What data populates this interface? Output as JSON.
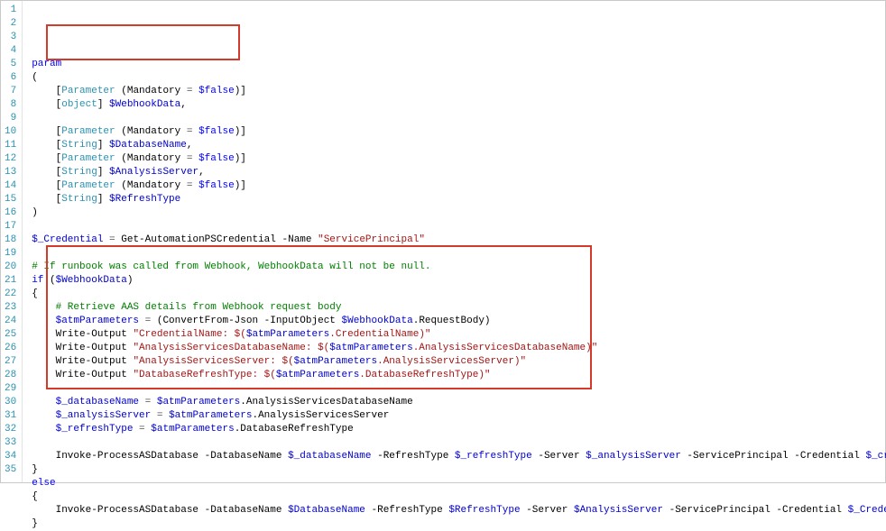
{
  "lines": [
    {
      "n": 1,
      "tokens": [
        {
          "t": "param",
          "c": "tok-kw"
        }
      ]
    },
    {
      "n": 2,
      "tokens": [
        {
          "t": "(",
          "c": "tok-p"
        }
      ]
    },
    {
      "n": 3,
      "tokens": [
        {
          "t": "    [",
          "c": "tok-p"
        },
        {
          "t": "Parameter",
          "c": "tok-type"
        },
        {
          "t": " (Mandatory ",
          "c": "tok-p"
        },
        {
          "t": "=",
          "c": "tok-op"
        },
        {
          "t": " ",
          "c": ""
        },
        {
          "t": "$false",
          "c": "tok-bool"
        },
        {
          "t": ")]",
          "c": "tok-p"
        }
      ]
    },
    {
      "n": 4,
      "tokens": [
        {
          "t": "    [",
          "c": "tok-p"
        },
        {
          "t": "object",
          "c": "tok-type"
        },
        {
          "t": "] ",
          "c": "tok-p"
        },
        {
          "t": "$WebhookData",
          "c": "tok-var"
        },
        {
          "t": ",",
          "c": "tok-p"
        }
      ]
    },
    {
      "n": 5,
      "tokens": [
        {
          "t": "",
          "c": ""
        }
      ]
    },
    {
      "n": 6,
      "tokens": [
        {
          "t": "    [",
          "c": "tok-p"
        },
        {
          "t": "Parameter",
          "c": "tok-type"
        },
        {
          "t": " (Mandatory ",
          "c": "tok-p"
        },
        {
          "t": "=",
          "c": "tok-op"
        },
        {
          "t": " ",
          "c": ""
        },
        {
          "t": "$false",
          "c": "tok-bool"
        },
        {
          "t": ")]",
          "c": "tok-p"
        }
      ]
    },
    {
      "n": 7,
      "tokens": [
        {
          "t": "    [",
          "c": "tok-p"
        },
        {
          "t": "String",
          "c": "tok-type"
        },
        {
          "t": "] ",
          "c": "tok-p"
        },
        {
          "t": "$DatabaseName",
          "c": "tok-var"
        },
        {
          "t": ",",
          "c": "tok-p"
        }
      ]
    },
    {
      "n": 8,
      "tokens": [
        {
          "t": "    [",
          "c": "tok-p"
        },
        {
          "t": "Parameter",
          "c": "tok-type"
        },
        {
          "t": " (Mandatory ",
          "c": "tok-p"
        },
        {
          "t": "=",
          "c": "tok-op"
        },
        {
          "t": " ",
          "c": ""
        },
        {
          "t": "$false",
          "c": "tok-bool"
        },
        {
          "t": ")]",
          "c": "tok-p"
        }
      ]
    },
    {
      "n": 9,
      "tokens": [
        {
          "t": "    [",
          "c": "tok-p"
        },
        {
          "t": "String",
          "c": "tok-type"
        },
        {
          "t": "] ",
          "c": "tok-p"
        },
        {
          "t": "$AnalysisServer",
          "c": "tok-var"
        },
        {
          "t": ",",
          "c": "tok-p"
        }
      ]
    },
    {
      "n": 10,
      "tokens": [
        {
          "t": "    [",
          "c": "tok-p"
        },
        {
          "t": "Parameter",
          "c": "tok-type"
        },
        {
          "t": " (Mandatory ",
          "c": "tok-p"
        },
        {
          "t": "=",
          "c": "tok-op"
        },
        {
          "t": " ",
          "c": ""
        },
        {
          "t": "$false",
          "c": "tok-bool"
        },
        {
          "t": ")]",
          "c": "tok-p"
        }
      ]
    },
    {
      "n": 11,
      "tokens": [
        {
          "t": "    [",
          "c": "tok-p"
        },
        {
          "t": "String",
          "c": "tok-type"
        },
        {
          "t": "] ",
          "c": "tok-p"
        },
        {
          "t": "$RefreshType",
          "c": "tok-var"
        }
      ]
    },
    {
      "n": 12,
      "tokens": [
        {
          "t": ")",
          "c": "tok-p"
        }
      ]
    },
    {
      "n": 13,
      "tokens": [
        {
          "t": "",
          "c": ""
        }
      ]
    },
    {
      "n": 14,
      "tokens": [
        {
          "t": "$_Credential",
          "c": "tok-var"
        },
        {
          "t": " ",
          "c": ""
        },
        {
          "t": "=",
          "c": "tok-op"
        },
        {
          "t": " ",
          "c": ""
        },
        {
          "t": "Get-AutomationPSCredential",
          "c": "tok-cmd"
        },
        {
          "t": " -Name ",
          "c": "tok-p"
        },
        {
          "t": "\"ServicePrincipal\"",
          "c": "tok-str"
        }
      ]
    },
    {
      "n": 15,
      "tokens": [
        {
          "t": "",
          "c": ""
        }
      ]
    },
    {
      "n": 16,
      "tokens": [
        {
          "t": "# If runbook was called from Webhook, WebhookData will not be null.",
          "c": "tok-com"
        }
      ]
    },
    {
      "n": 17,
      "tokens": [
        {
          "t": "if",
          "c": "tok-kw"
        },
        {
          "t": " (",
          "c": "tok-p"
        },
        {
          "t": "$WebhookData",
          "c": "tok-var"
        },
        {
          "t": ")",
          "c": "tok-p"
        }
      ]
    },
    {
      "n": 18,
      "tokens": [
        {
          "t": "{",
          "c": "tok-p"
        }
      ]
    },
    {
      "n": 19,
      "tokens": [
        {
          "t": "    ",
          "c": ""
        },
        {
          "t": "# Retrieve AAS details from Webhook request body",
          "c": "tok-com"
        }
      ]
    },
    {
      "n": 20,
      "tokens": [
        {
          "t": "    ",
          "c": ""
        },
        {
          "t": "$atmParameters",
          "c": "tok-var"
        },
        {
          "t": " ",
          "c": ""
        },
        {
          "t": "=",
          "c": "tok-op"
        },
        {
          "t": " (",
          "c": "tok-p"
        },
        {
          "t": "ConvertFrom-Json",
          "c": "tok-cmd"
        },
        {
          "t": " -InputObject ",
          "c": "tok-p"
        },
        {
          "t": "$WebhookData",
          "c": "tok-var"
        },
        {
          "t": ".RequestBody)",
          "c": "tok-prop"
        }
      ]
    },
    {
      "n": 21,
      "tokens": [
        {
          "t": "    ",
          "c": ""
        },
        {
          "t": "Write-Output",
          "c": "tok-cmd"
        },
        {
          "t": " ",
          "c": ""
        },
        {
          "t": "\"CredentialName: $(",
          "c": "tok-str"
        },
        {
          "t": "$atmParameters",
          "c": "tok-var"
        },
        {
          "t": ".CredentialName",
          "c": "tok-str"
        },
        {
          "t": ")\"",
          "c": "tok-str"
        }
      ]
    },
    {
      "n": 22,
      "tokens": [
        {
          "t": "    ",
          "c": ""
        },
        {
          "t": "Write-Output",
          "c": "tok-cmd"
        },
        {
          "t": " ",
          "c": ""
        },
        {
          "t": "\"AnalysisServicesDatabaseName: $(",
          "c": "tok-str"
        },
        {
          "t": "$atmParameters",
          "c": "tok-var"
        },
        {
          "t": ".AnalysisServicesDatabaseName",
          "c": "tok-str"
        },
        {
          "t": ")\"",
          "c": "tok-str"
        }
      ]
    },
    {
      "n": 23,
      "tokens": [
        {
          "t": "    ",
          "c": ""
        },
        {
          "t": "Write-Output",
          "c": "tok-cmd"
        },
        {
          "t": " ",
          "c": ""
        },
        {
          "t": "\"AnalysisServicesServer: $(",
          "c": "tok-str"
        },
        {
          "t": "$atmParameters",
          "c": "tok-var"
        },
        {
          "t": ".AnalysisServicesServer",
          "c": "tok-str"
        },
        {
          "t": ")\"",
          "c": "tok-str"
        }
      ]
    },
    {
      "n": 24,
      "tokens": [
        {
          "t": "    ",
          "c": ""
        },
        {
          "t": "Write-Output",
          "c": "tok-cmd"
        },
        {
          "t": " ",
          "c": ""
        },
        {
          "t": "\"DatabaseRefreshType: $(",
          "c": "tok-str"
        },
        {
          "t": "$atmParameters",
          "c": "tok-var"
        },
        {
          "t": ".DatabaseRefreshType",
          "c": "tok-str"
        },
        {
          "t": ")\"",
          "c": "tok-str"
        }
      ]
    },
    {
      "n": 25,
      "tokens": [
        {
          "t": "",
          "c": ""
        }
      ]
    },
    {
      "n": 26,
      "tokens": [
        {
          "t": "    ",
          "c": ""
        },
        {
          "t": "$_databaseName",
          "c": "tok-var"
        },
        {
          "t": " ",
          "c": ""
        },
        {
          "t": "=",
          "c": "tok-op"
        },
        {
          "t": " ",
          "c": ""
        },
        {
          "t": "$atmParameters",
          "c": "tok-var"
        },
        {
          "t": ".AnalysisServicesDatabaseName",
          "c": "tok-prop"
        }
      ]
    },
    {
      "n": 27,
      "tokens": [
        {
          "t": "    ",
          "c": ""
        },
        {
          "t": "$_analysisServer",
          "c": "tok-var"
        },
        {
          "t": " ",
          "c": ""
        },
        {
          "t": "=",
          "c": "tok-op"
        },
        {
          "t": " ",
          "c": ""
        },
        {
          "t": "$atmParameters",
          "c": "tok-var"
        },
        {
          "t": ".AnalysisServicesServer",
          "c": "tok-prop"
        }
      ]
    },
    {
      "n": 28,
      "tokens": [
        {
          "t": "    ",
          "c": ""
        },
        {
          "t": "$_refreshType",
          "c": "tok-var"
        },
        {
          "t": " ",
          "c": ""
        },
        {
          "t": "=",
          "c": "tok-op"
        },
        {
          "t": " ",
          "c": ""
        },
        {
          "t": "$atmParameters",
          "c": "tok-var"
        },
        {
          "t": ".DatabaseRefreshType",
          "c": "tok-prop"
        }
      ]
    },
    {
      "n": 29,
      "tokens": [
        {
          "t": "",
          "c": ""
        }
      ]
    },
    {
      "n": 30,
      "tokens": [
        {
          "t": "    ",
          "c": ""
        },
        {
          "t": "Invoke-ProcessASDatabase",
          "c": "tok-cmd"
        },
        {
          "t": " -DatabaseName ",
          "c": "tok-p"
        },
        {
          "t": "$_databaseName",
          "c": "tok-var"
        },
        {
          "t": " -RefreshType ",
          "c": "tok-p"
        },
        {
          "t": "$_refreshType",
          "c": "tok-var"
        },
        {
          "t": " -Server ",
          "c": "tok-p"
        },
        {
          "t": "$_analysisServer",
          "c": "tok-var"
        },
        {
          "t": " -ServicePrincipal -Credential ",
          "c": "tok-p"
        },
        {
          "t": "$_credential",
          "c": "tok-var"
        }
      ]
    },
    {
      "n": 31,
      "tokens": [
        {
          "t": "}",
          "c": "tok-p"
        }
      ]
    },
    {
      "n": 32,
      "tokens": [
        {
          "t": "else",
          "c": "tok-kw"
        }
      ]
    },
    {
      "n": 33,
      "tokens": [
        {
          "t": "{",
          "c": "tok-p"
        }
      ]
    },
    {
      "n": 34,
      "tokens": [
        {
          "t": "    ",
          "c": ""
        },
        {
          "t": "Invoke-ProcessASDatabase",
          "c": "tok-cmd"
        },
        {
          "t": " -DatabaseName ",
          "c": "tok-p"
        },
        {
          "t": "$DatabaseName",
          "c": "tok-var"
        },
        {
          "t": " -RefreshType ",
          "c": "tok-p"
        },
        {
          "t": "$RefreshType",
          "c": "tok-var"
        },
        {
          "t": " -Server ",
          "c": "tok-p"
        },
        {
          "t": "$AnalysisServer",
          "c": "tok-var"
        },
        {
          "t": " -ServicePrincipal -Credential ",
          "c": "tok-p"
        },
        {
          "t": "$_Credential",
          "c": "tok-var"
        }
      ]
    },
    {
      "n": 35,
      "tokens": [
        {
          "t": "}",
          "c": "tok-p"
        }
      ]
    }
  ]
}
